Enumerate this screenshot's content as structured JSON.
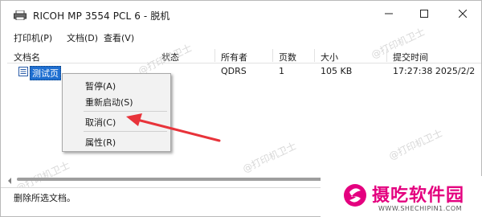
{
  "window": {
    "title": "RICOH MP 3554 PCL 6 - 脱机"
  },
  "menu": {
    "items": [
      "打印机(P)",
      "文档(D)",
      "查看(V)"
    ]
  },
  "columns": [
    "文档名",
    "状态",
    "所有者",
    "页数",
    "大小",
    "提交时间"
  ],
  "rows": [
    {
      "doc_name": "测试页",
      "status": "",
      "owner": "QDRS",
      "pages": "1",
      "size": "105 KB",
      "submitted": "17:27:38   2025/2/2"
    }
  ],
  "context_menu": {
    "items": [
      "暂停(A)",
      "重新启动(S)",
      "取消(C)",
      "属性(R)"
    ],
    "highlighted": "取消(C)"
  },
  "status_bar": {
    "text": "删除所选文档。"
  },
  "watermark": {
    "text": "@打印机卫士"
  },
  "logo": {
    "title": "摄吃软件园",
    "subtitle": "WWW.SHECHIPIN1.COM"
  },
  "colors": {
    "selection": "#1f6fd1",
    "arrow": "#e8333a",
    "brand": "#e4007f"
  },
  "icons": {
    "app": "printer-icon",
    "document": "document-icon",
    "minimize": "minimize-icon",
    "maximize": "maximize-icon",
    "close": "close-icon"
  }
}
